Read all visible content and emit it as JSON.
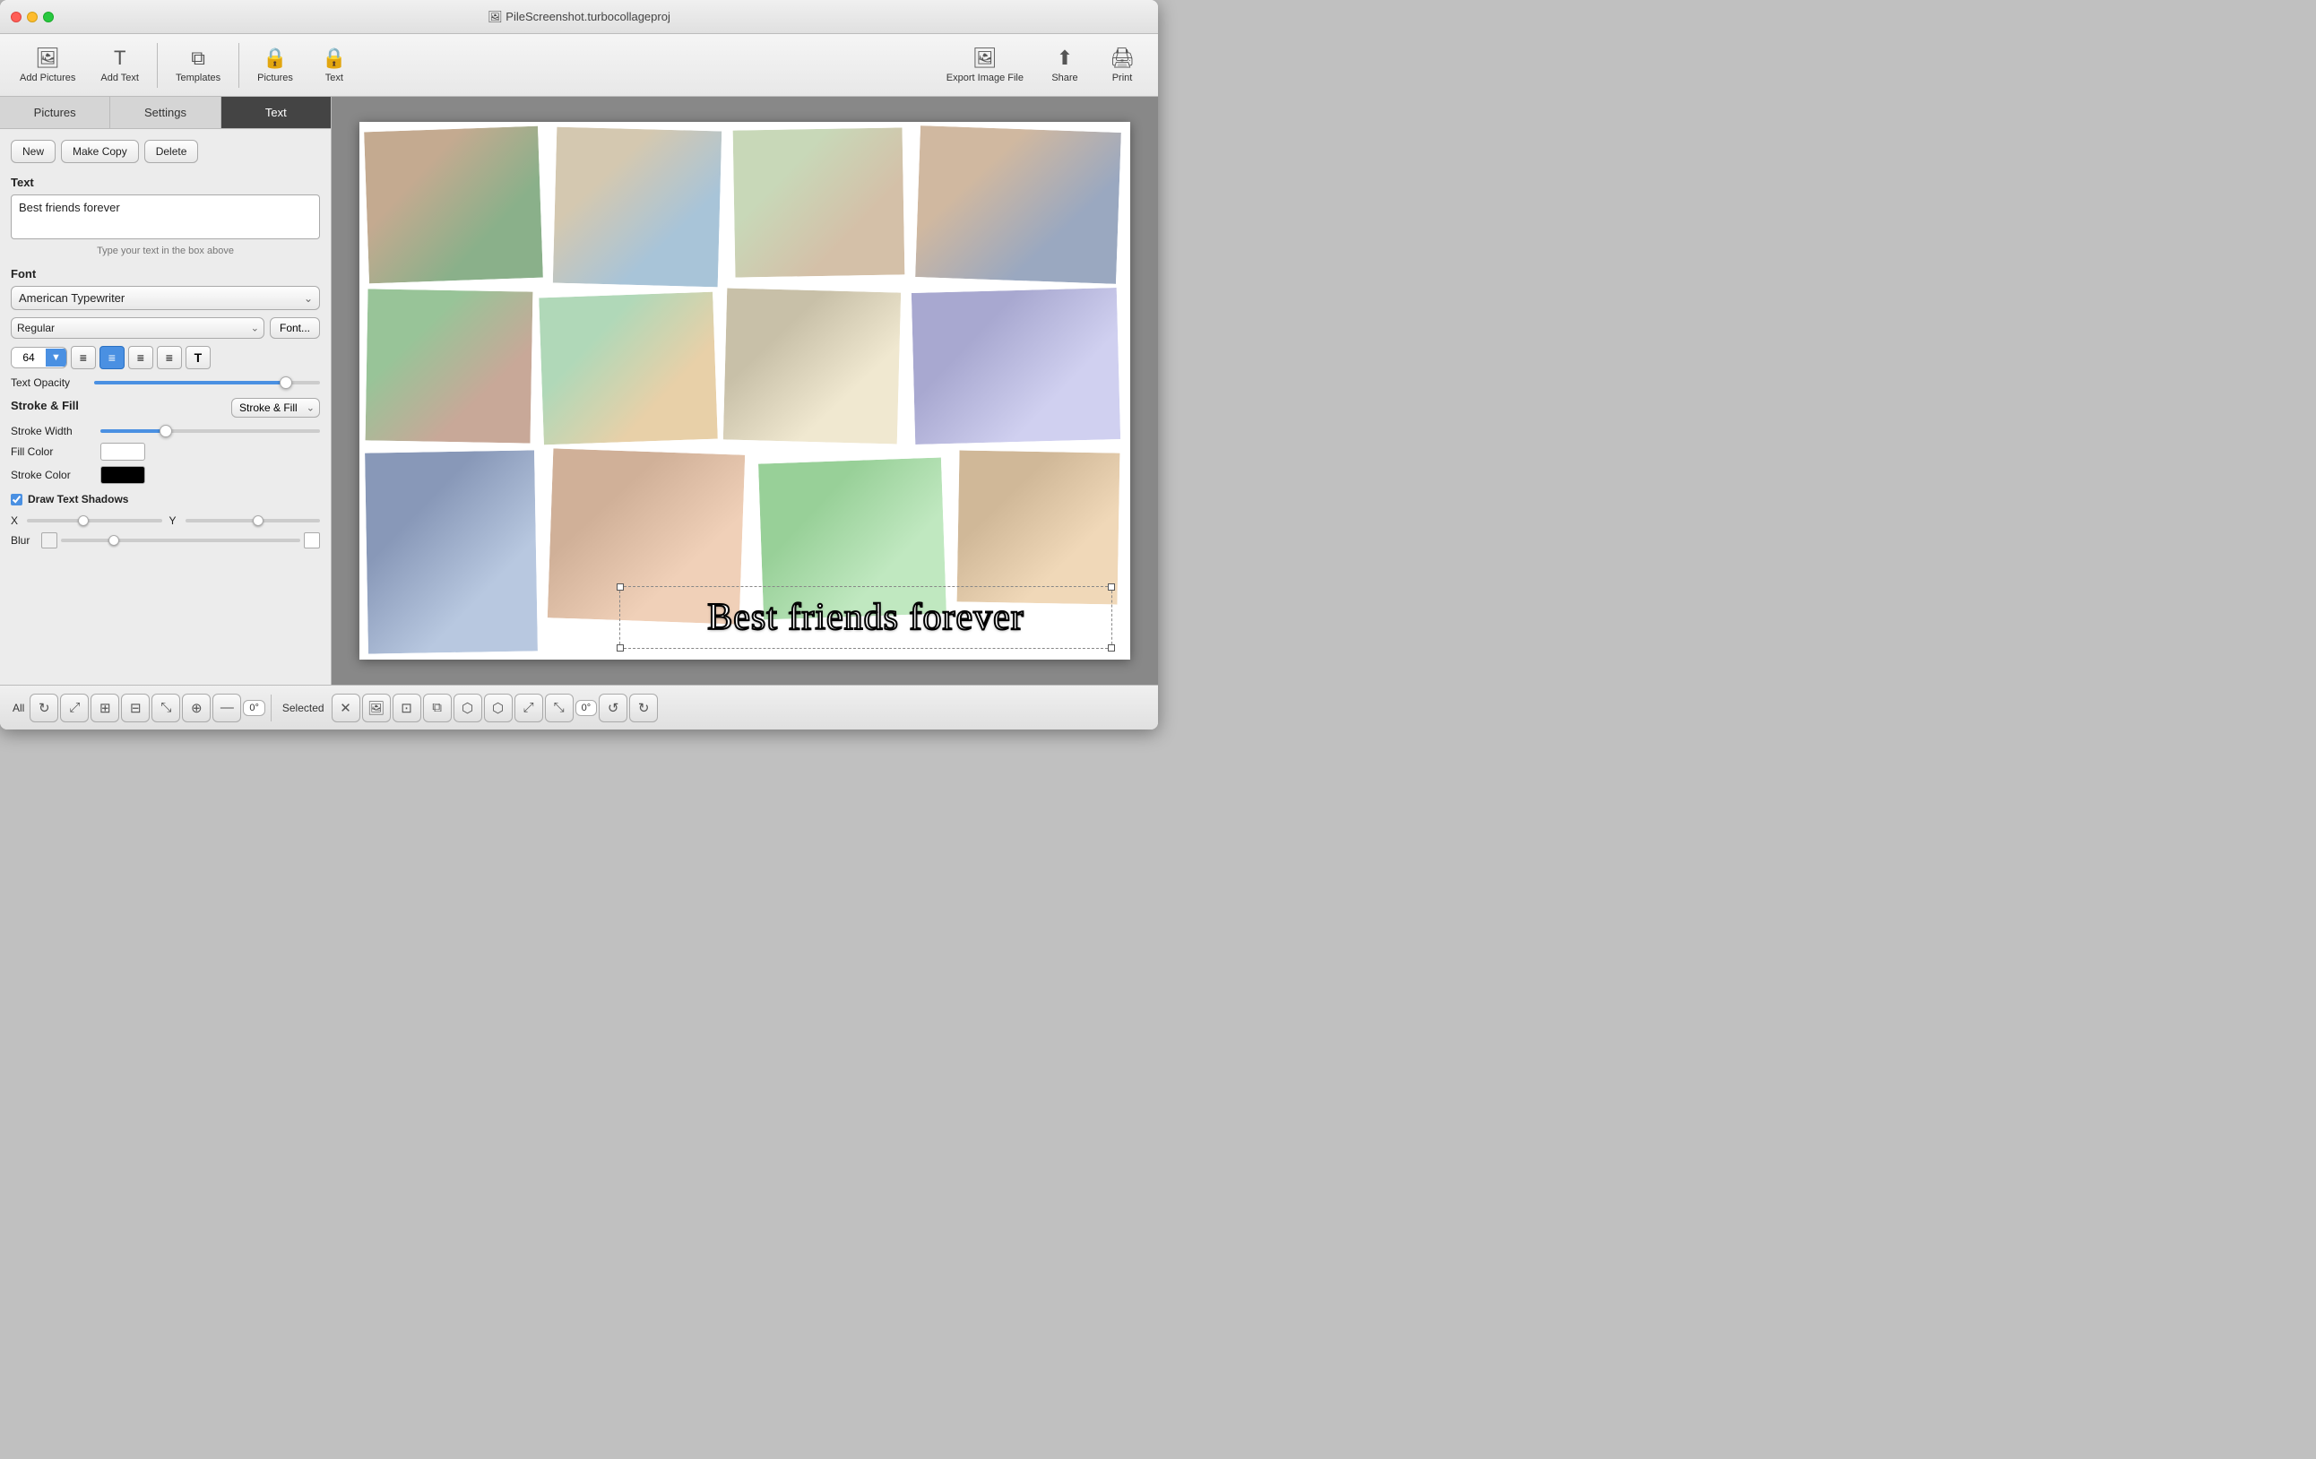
{
  "window": {
    "title": "🖼 PileScreenshot.turbocollageproj"
  },
  "toolbar": {
    "add_pictures_label": "Add Pictures",
    "add_text_label": "Add Text",
    "templates_label": "Templates",
    "pictures_label": "Pictures",
    "text_label": "Text",
    "export_label": "Export Image File",
    "share_label": "Share",
    "print_label": "Print"
  },
  "sidebar_tabs": {
    "pictures": "Pictures",
    "settings": "Settings",
    "text": "Text"
  },
  "actions": {
    "new": "New",
    "make_copy": "Make Copy",
    "delete": "Delete"
  },
  "text_section": {
    "label": "Text",
    "value": "Best friends forever",
    "hint": "Type your text in the box above"
  },
  "font_section": {
    "label": "Font",
    "font_name": "American Typewriter",
    "style": "Regular",
    "font_btn": "Font...",
    "size": "64"
  },
  "alignment": {
    "left": "≡",
    "center": "≡",
    "right": "≡",
    "justify": "≡"
  },
  "opacity": {
    "label": "Text Opacity",
    "value": 90
  },
  "stroke_fill": {
    "label": "Stroke & Fill",
    "type": "Stroke & Fill",
    "stroke_width_label": "Stroke Width",
    "fill_color_label": "Fill Color",
    "stroke_color_label": "Stroke Color"
  },
  "shadow": {
    "label": "Draw Text Shadows",
    "checked": true,
    "x_label": "X",
    "y_label": "Y",
    "blur_label": "Blur"
  },
  "text_overlay": {
    "content": "Best friends forever"
  },
  "bottom_toolbar": {
    "all_label": "All",
    "selected_label": "Selected",
    "degree_value": "0°"
  }
}
